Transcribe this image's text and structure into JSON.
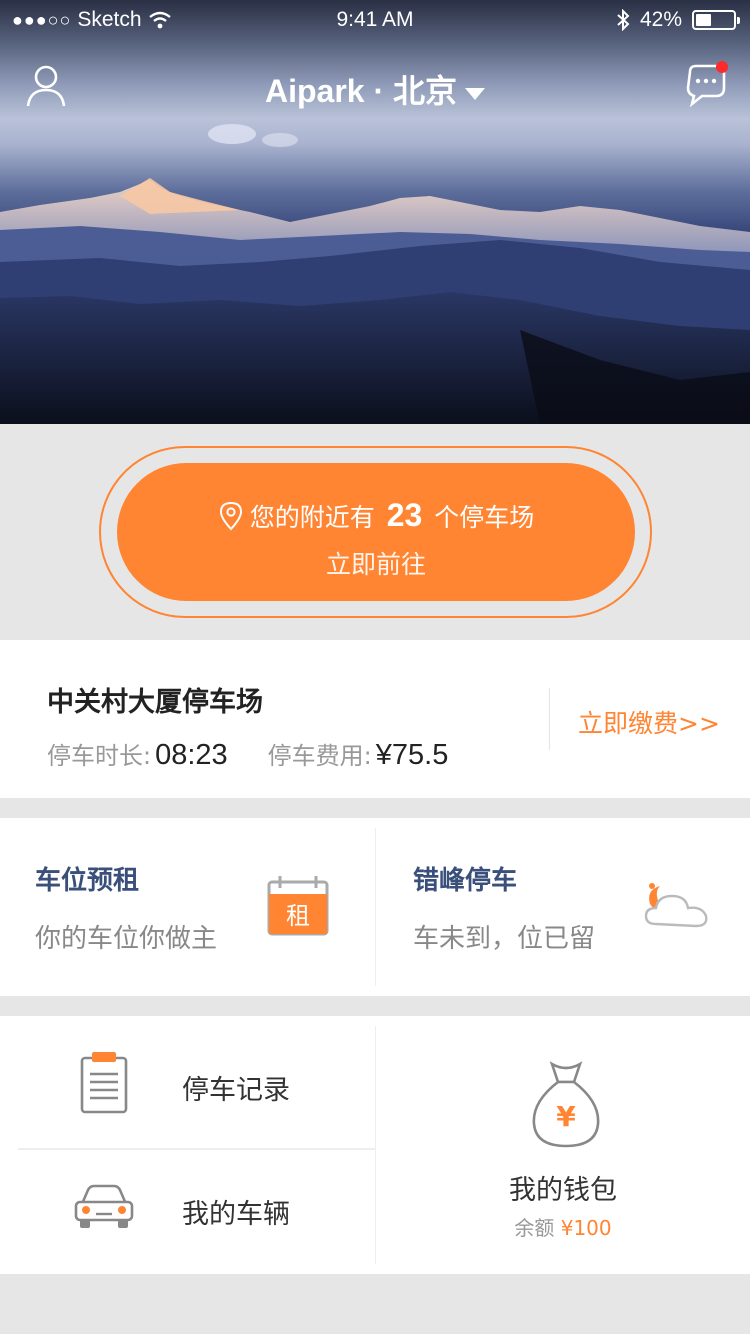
{
  "status_bar": {
    "signal": "●●●○○",
    "carrier": "Sketch",
    "time": "9:41 AM",
    "battery": "42%",
    "battery_level": 0.42
  },
  "header": {
    "title": "Aipark · 北京",
    "user_icon": "user-icon",
    "message_icon": "message-bubble-icon",
    "has_unread": true
  },
  "nearby": {
    "prefix": "您的附近有",
    "count": "23",
    "suffix": "个停车场",
    "action": "立即前往",
    "icon": "location-pin-icon"
  },
  "parking": {
    "name": "中关村大厦停车场",
    "duration_label": "停车时长:",
    "duration": "08:23",
    "fee_label": "停车费用:",
    "fee": "¥75.5",
    "pay_action": "立即缴费>>"
  },
  "features": [
    {
      "title": "车位预租",
      "subtitle": "你的车位你做主",
      "icon": "calendar-rent-icon",
      "icon_text": "租"
    },
    {
      "title": "错峰停车",
      "subtitle": "车未到，位已留",
      "icon": "moon-cloud-icon"
    }
  ],
  "grid": {
    "records": {
      "label": "停车记录",
      "icon": "clipboard-icon"
    },
    "vehicles": {
      "label": "我的车辆",
      "icon": "car-icon"
    },
    "wallet": {
      "label": "我的钱包",
      "balance_label": "余额",
      "balance": "¥100",
      "icon": "money-bag-icon",
      "icon_text": "¥"
    }
  },
  "colors": {
    "accent": "#ff8533",
    "feature_title": "#3a4f7a",
    "background": "#e6e6e6",
    "unread_dot": "#ff2a2a"
  }
}
